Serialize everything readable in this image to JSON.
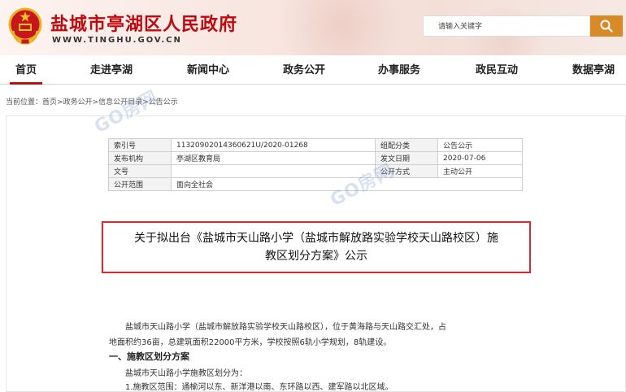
{
  "header": {
    "site_title": "盐城市亭湖区人民政府",
    "site_domain": "WWW.TINGHU.GOV.CN",
    "emblem_icon": "national-emblem-icon",
    "brand_red": "#c0080f"
  },
  "search": {
    "placeholder": "请输入关键字",
    "button_icon": "search-icon",
    "button_color": "#d78a27"
  },
  "nav": {
    "items": [
      {
        "label": "首页",
        "active": true
      },
      {
        "label": "走进亭湖"
      },
      {
        "label": "新闻中心"
      },
      {
        "label": "政务公开"
      },
      {
        "label": "办事服务"
      },
      {
        "label": "政民互动"
      },
      {
        "label": "数据亭湖"
      }
    ],
    "active_color": "#b70f12"
  },
  "breadcrumb": {
    "prefix": "当前位置：",
    "items": [
      "首页",
      "政务公开",
      "信息公开目录",
      "公告公示"
    ],
    "separator": ">"
  },
  "meta_table": {
    "rows": [
      {
        "label1": "索引号",
        "value1": "11320902014360621U/2020-01268",
        "label2": "组配分类",
        "value2": "公告公示"
      },
      {
        "label1": "发布机构",
        "value1": "亭湖区教育局",
        "label2": "发文日期",
        "value2": "2020-07-06"
      },
      {
        "label1": "文号",
        "value1": "",
        "label2": "公开方式",
        "value2": "主动公开"
      },
      {
        "label1": "公开范围",
        "value1": "面向全社会",
        "label2": "",
        "value2": ""
      }
    ]
  },
  "article": {
    "title_line1": "关于拟出台《盐城市天山路小学（盐城市解放路实验学校天山路校区）施",
    "title_line2": "教区划分方案》公示",
    "highlight_color": "#e3262d",
    "para1_line1": "盐城市天山路小学（盐城市解放路实验学校天山路校区），位于黄海路与天山路交汇处，占",
    "para1_line2": "地面积约36亩，总建筑面积22000平方米，学校按照6轨小学规划，8轨建设。",
    "section1_heading": "一、施教区划分方案",
    "section1_line1": "盐城市天山路小学施教区划分为：",
    "section1_line2": "1.施教区范围：通榆河以东、新洋港以南、东环路以西、建军路以北区域。"
  },
  "watermarks": [
    "GO房网",
    "GO房网"
  ]
}
